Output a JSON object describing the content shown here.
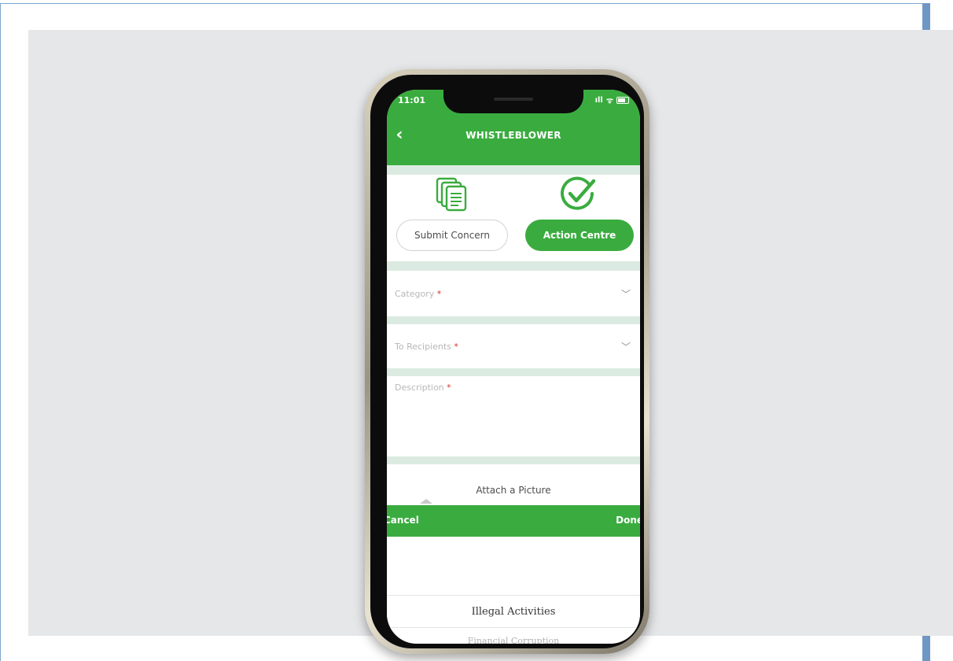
{
  "status_bar": {
    "time": "11:01",
    "signal": "ıll",
    "wifi": "ᯤ"
  },
  "header": {
    "back_glyph": "‹",
    "title": "WHISTLEBLOWER"
  },
  "tabs": [
    {
      "label": "Submit Concern",
      "icon": "documents-icon",
      "active": false
    },
    {
      "label": "Action Centre",
      "icon": "check-circle-icon",
      "active": true
    }
  ],
  "form": {
    "category": {
      "label": "Category",
      "required_mark": "*"
    },
    "recipients": {
      "label": "To Recipients",
      "required_mark": "*"
    },
    "description": {
      "label": "Description",
      "required_mark": "*"
    },
    "attach_label": "Attach a Picture"
  },
  "picker": {
    "cancel_label": "Cancel",
    "done_label": "Done",
    "options": [
      "Illegal Activities",
      "Financial Corruption"
    ]
  },
  "colors": {
    "brand_green": "#3aac3f",
    "band": "#dcebe1",
    "stage_bg": "#e6e7e9",
    "required": "#d2372b"
  }
}
